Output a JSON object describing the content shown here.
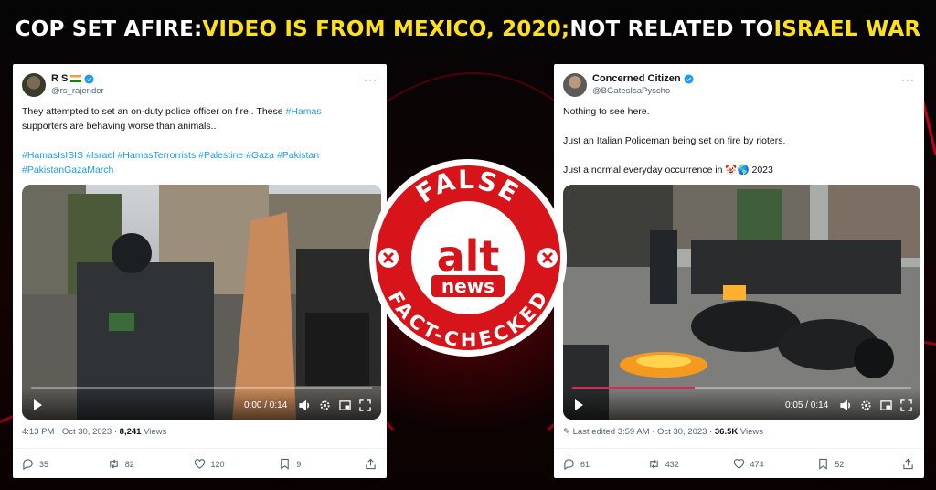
{
  "headline": {
    "part1": "COP SET AFIRE: ",
    "part2": "VIDEO IS FROM MEXICO, 2020; ",
    "part3": "NOT RELATED TO ",
    "part4": "ISRAEL WAR"
  },
  "colors": {
    "accent_yellow": "#ffe11a",
    "stamp_red": "#d7141a",
    "link_blue": "#1d9bf0",
    "video_progress": "#e0245e"
  },
  "stamp": {
    "top": "FALSE",
    "logo": "alt",
    "sub": "news",
    "bottom": "FACT-CHECKED"
  },
  "left_tweet": {
    "display_name": "R S",
    "handle": "@rs_rajender",
    "text_line1_a": "They attempted to set an on-duty police officer on fire.. These ",
    "text_line1_hash": "#Hamas",
    "text_line2": "supporters are behaving worse than animals..",
    "hashtags_line1": "#HamasIsISIS #Israel #HamasTerrorrists #Palestine #Gaza #Pakistan",
    "hashtags_line2": "#PakistanGazaMarch",
    "video_time": "0:00 / 0:14",
    "video_progress": 0.0,
    "timestamp": "4:13 PM · Oct 30, 2023 · ",
    "views_count": "8,241",
    "views_label": " Views",
    "replies": "35",
    "reposts": "82",
    "likes": "120",
    "bookmarks": "9"
  },
  "right_tweet": {
    "display_name": "Concerned Citizen",
    "handle": "@BGatesIsaPyscho",
    "text_line1": "Nothing to see here.",
    "text_line2": "Just an Italian Policeman being set on fire by rioters.",
    "text_line3": "Just a normal everyday occurrence in 🤡🌎 2023",
    "video_time": "0:05 / 0:14",
    "video_progress": 0.36,
    "timestamp": "Last edited 3:59 AM · Oct 30, 2023 · ",
    "views_count": "36.5K",
    "views_label": " Views",
    "replies": "61",
    "reposts": "432",
    "likes": "474",
    "bookmarks": "52"
  }
}
